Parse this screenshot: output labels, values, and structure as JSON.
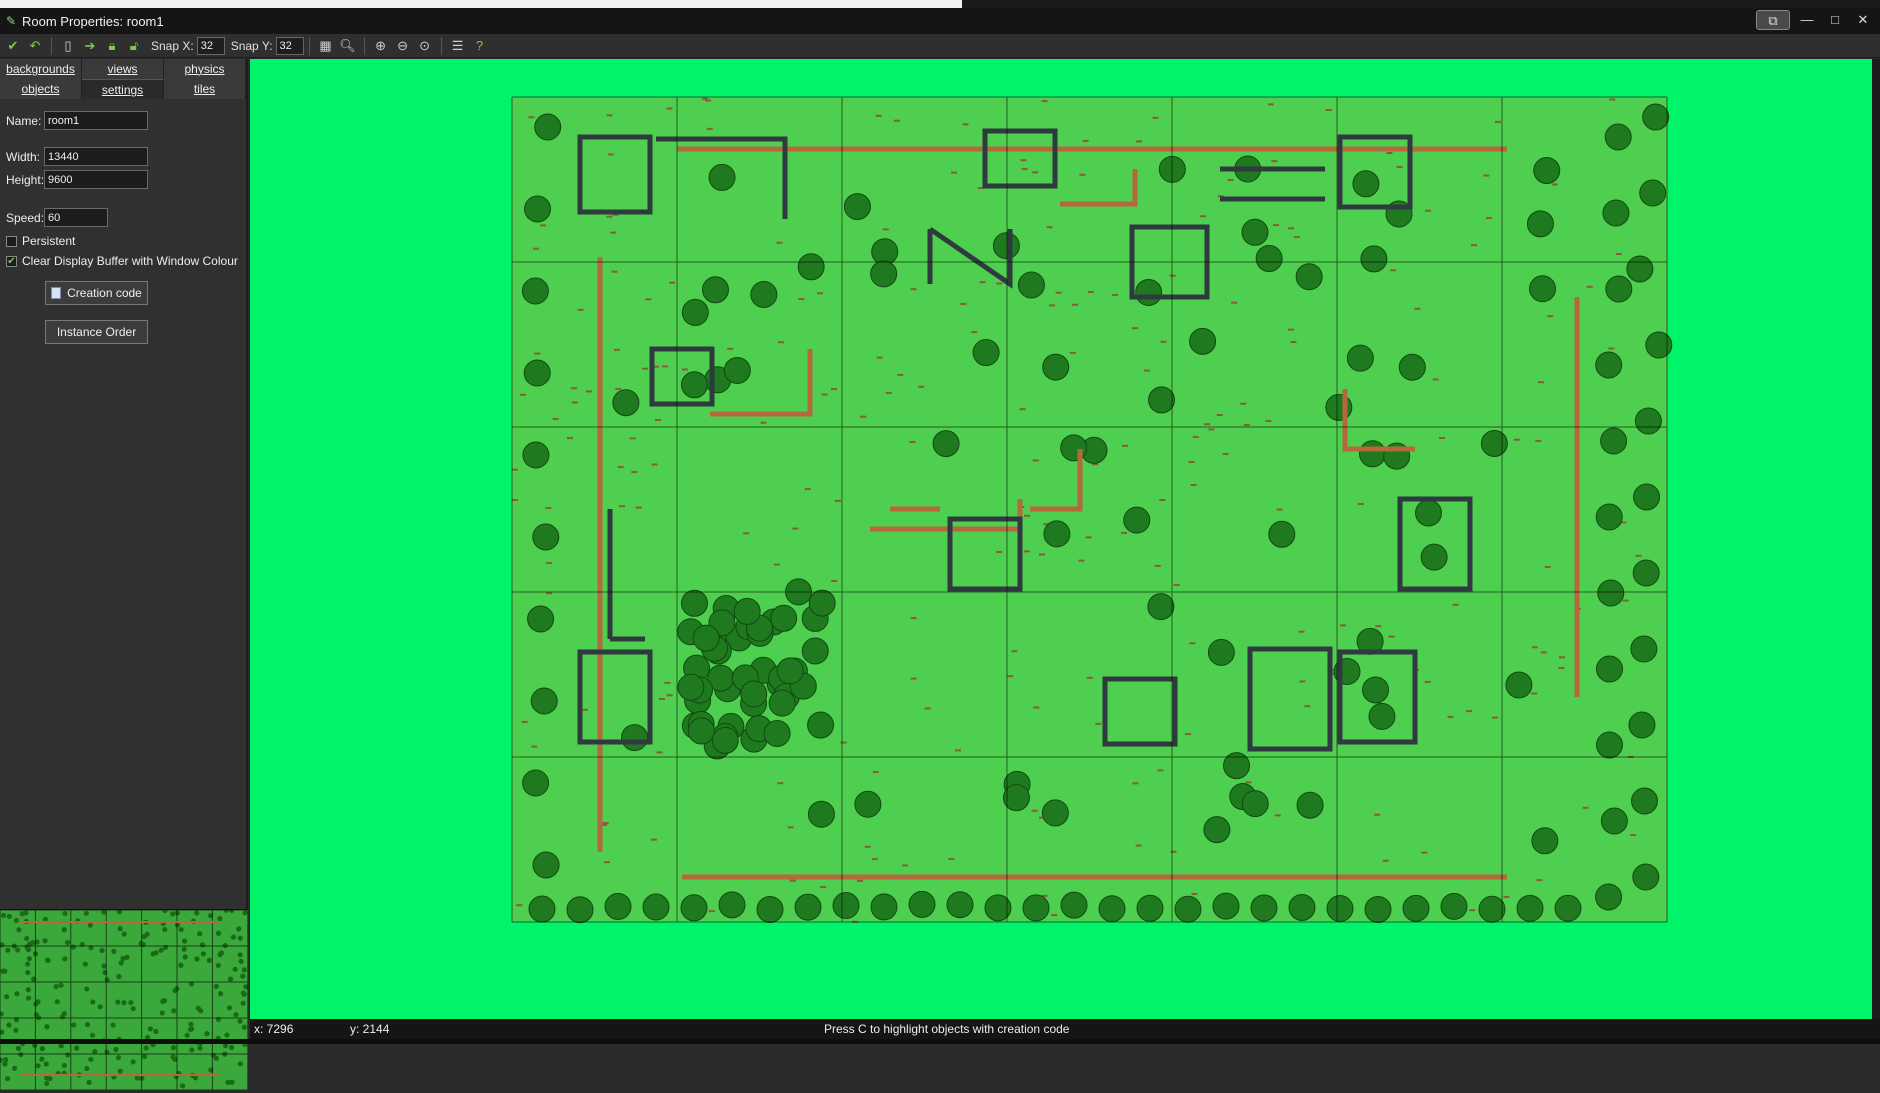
{
  "window": {
    "title": "Room Properties: room1",
    "controls": [
      "restore-down",
      "minimize",
      "maximize",
      "close"
    ]
  },
  "toolbar": {
    "snap_x_label": "Snap X:",
    "snap_x_value": "32",
    "snap_y_label": "Snap Y:",
    "snap_y_value": "32"
  },
  "tabs_row1": [
    "backgrounds",
    "views",
    "physics"
  ],
  "tabs_row2": [
    "objects",
    "settings",
    "tiles"
  ],
  "active_tab": "settings",
  "settings": {
    "name_label": "Name:",
    "name_value": "room1",
    "width_label": "Width:",
    "width_value": "13440",
    "height_label": "Height:",
    "height_value": "9600",
    "speed_label": "Speed:",
    "speed_value": "60",
    "persistent_label": "Persistent",
    "persistent_checked": false,
    "clear_buffer_label": "Clear Display Buffer with Window Colour",
    "clear_buffer_checked": true,
    "creation_code_label": "Creation code",
    "instance_order_label": "Instance Order"
  },
  "status": {
    "x": "x: 7296",
    "y": "y: 2144",
    "hint": "Press C to highlight objects with creation code"
  },
  "colors": {
    "room_background": "#00f46a",
    "grass": "#4fcf4f",
    "tree": "#1f7a1f",
    "wall": "#2f3a3f",
    "fence": "#b5683b"
  },
  "icons": [
    "check-icon",
    "undo-icon",
    "new-icon",
    "arrow-icon",
    "lock-icon",
    "unlock-icon",
    "grid-icon",
    "zoom-icon",
    "zoom-in-icon",
    "zoom-out-icon",
    "zoom-reset-icon",
    "list-icon",
    "help-icon",
    "document-icon"
  ]
}
